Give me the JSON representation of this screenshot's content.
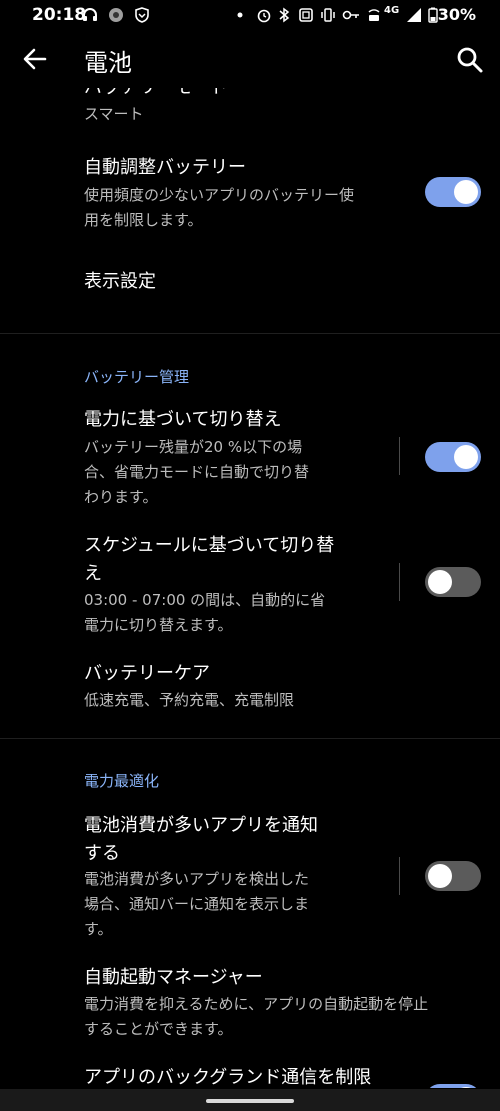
{
  "status_bar": {
    "time": "20:18",
    "network": "4G",
    "battery": "30%"
  },
  "header": {
    "title": "電池"
  },
  "settings": {
    "battery_mode": {
      "title": "バッテリーモード",
      "value": "スマート"
    },
    "adaptive_battery": {
      "title": "自動調整バッテリー",
      "desc": [
        "使用頻度の少ないアプリのバッテリー使",
        "用を制限します。"
      ],
      "enabled": true
    },
    "display_settings": {
      "title": "表示設定"
    },
    "section_battery_management": "バッテリー管理",
    "switch_by_power": {
      "title": "電力に基づいて切り替え",
      "desc": [
        "バッテリー残量が20 %以下の場",
        "合、省電力モードに自動で切り替",
        "わります。"
      ],
      "enabled": true
    },
    "switch_by_schedule": {
      "title": [
        "スケジュールに基づいて切り替",
        "え"
      ],
      "desc": [
        "03:00 - 07:00 の間は、自動的に省",
        "電力に切り替えます。"
      ],
      "enabled": false
    },
    "battery_care": {
      "title": "バッテリーケア",
      "desc": "低速充電、予約充電、充電制限"
    },
    "section_power_optimization": "電力最適化",
    "notify_heavy_apps": {
      "title": [
        "電池消費が多いアプリを通知",
        "する"
      ],
      "desc": [
        "電池消費が多いアプリを検出した",
        "場合、通知バーに通知を表示しま",
        "す。"
      ],
      "enabled": false
    },
    "auto_start_manager": {
      "title": "自動起動マネージャー",
      "desc": [
        "電力消費を抑えるために、アプリの自動起動を停止",
        "することができます。"
      ]
    },
    "restrict_background": {
      "title": "アプリのバックグランド通信を制限",
      "enabled": true
    }
  }
}
